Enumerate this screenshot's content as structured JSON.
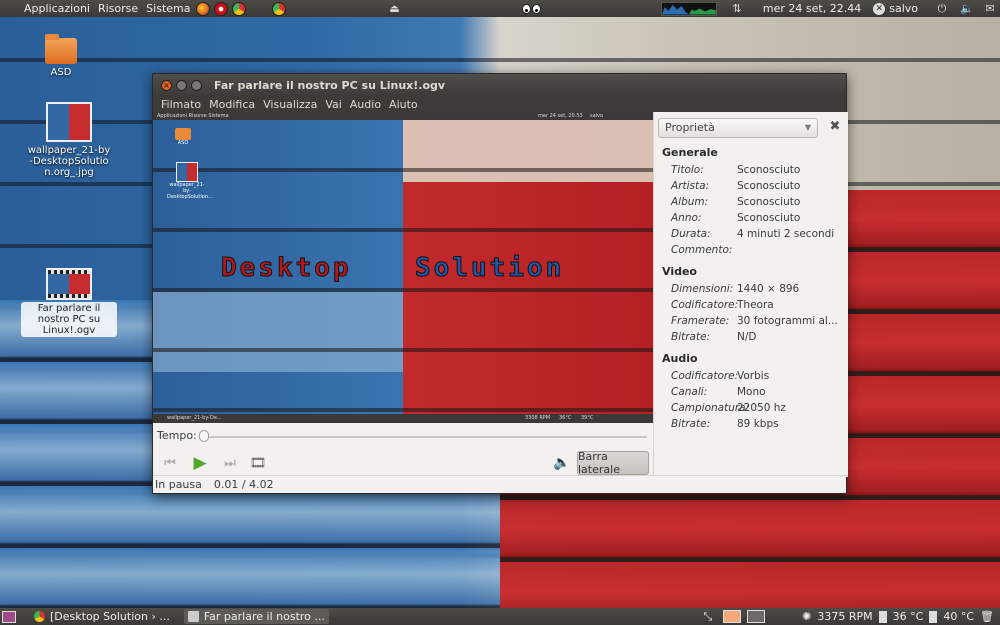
{
  "top_panel": {
    "menus": [
      "Applicazioni",
      "Risorse",
      "Sistema"
    ],
    "clock": "mer 24 set, 22.44",
    "user": "salvo"
  },
  "desktop": {
    "icons": [
      {
        "label": "ASD"
      },
      {
        "label": "wallpaper_21-by-DesktopSolution.org_.jpg"
      },
      {
        "label": "Far parlare il nostro PC su Linux!.ogv"
      }
    ]
  },
  "window": {
    "title": "Far parlare il nostro PC su Linux!.ogv",
    "menubar": [
      "Filmato",
      "Modifica",
      "Visualizza",
      "Vai",
      "Audio",
      "Aiuto"
    ],
    "video": {
      "overlay_left": "Desktop",
      "overlay_right": "Solution",
      "mini_panel": "Applicazioni  Risorse  Sistema",
      "mini_clock": "mer 24 set, 20.53",
      "mini_user": "salvo",
      "mini_icon_1": "ASD",
      "mini_icon_2": "wallpaper_21-by-DesktopSolution...",
      "mini_task": "wallpaper_21-by-De...",
      "mini_rpm": "3308 RPM",
      "mini_temp1": "36°C",
      "mini_temp2": "39°C"
    },
    "seek_label": "Tempo:",
    "seek_fraction": 0.0,
    "sidebar_button": "Barra laterale",
    "status": "In pausa",
    "time": "0.01 / 4.02"
  },
  "sidebar": {
    "combo": "Proprietà",
    "sections": [
      {
        "title": "Generale",
        "rows": [
          {
            "k": "Titolo:",
            "v": "Sconosciuto"
          },
          {
            "k": "Artista:",
            "v": "Sconosciuto"
          },
          {
            "k": "Album:",
            "v": "Sconosciuto"
          },
          {
            "k": "Anno:",
            "v": "Sconosciuto"
          },
          {
            "k": "Durata:",
            "v": "4 minuti 2 secondi"
          },
          {
            "k": "Commento:",
            "v": ""
          }
        ]
      },
      {
        "title": "Video",
        "rows": [
          {
            "k": "Dimensioni:",
            "v": "1440 × 896"
          },
          {
            "k": "Codificatore:",
            "v": "Theora"
          },
          {
            "k": "Framerate:",
            "v": "30 fotogrammi al..."
          },
          {
            "k": "Bitrate:",
            "v": "N/D"
          }
        ]
      },
      {
        "title": "Audio",
        "rows": [
          {
            "k": "Codificatore:",
            "v": "Vorbis"
          },
          {
            "k": "Canali:",
            "v": "Mono"
          },
          {
            "k": "Campionatura:",
            "v": "22050 hz"
          },
          {
            "k": "Bitrate:",
            "v": "89 kbps"
          }
        ]
      }
    ]
  },
  "bottom_panel": {
    "tasks": [
      {
        "label": "[Desktop Solution › ..."
      },
      {
        "label": "Far parlare il nostro ..."
      }
    ],
    "rpm": "3375 RPM",
    "temp1": "36 °C",
    "temp2": "40 °C"
  },
  "colors": {
    "accent_orange": "#e2672a",
    "play_green": "#53a92a",
    "panel_dark": "#3c3b37"
  }
}
